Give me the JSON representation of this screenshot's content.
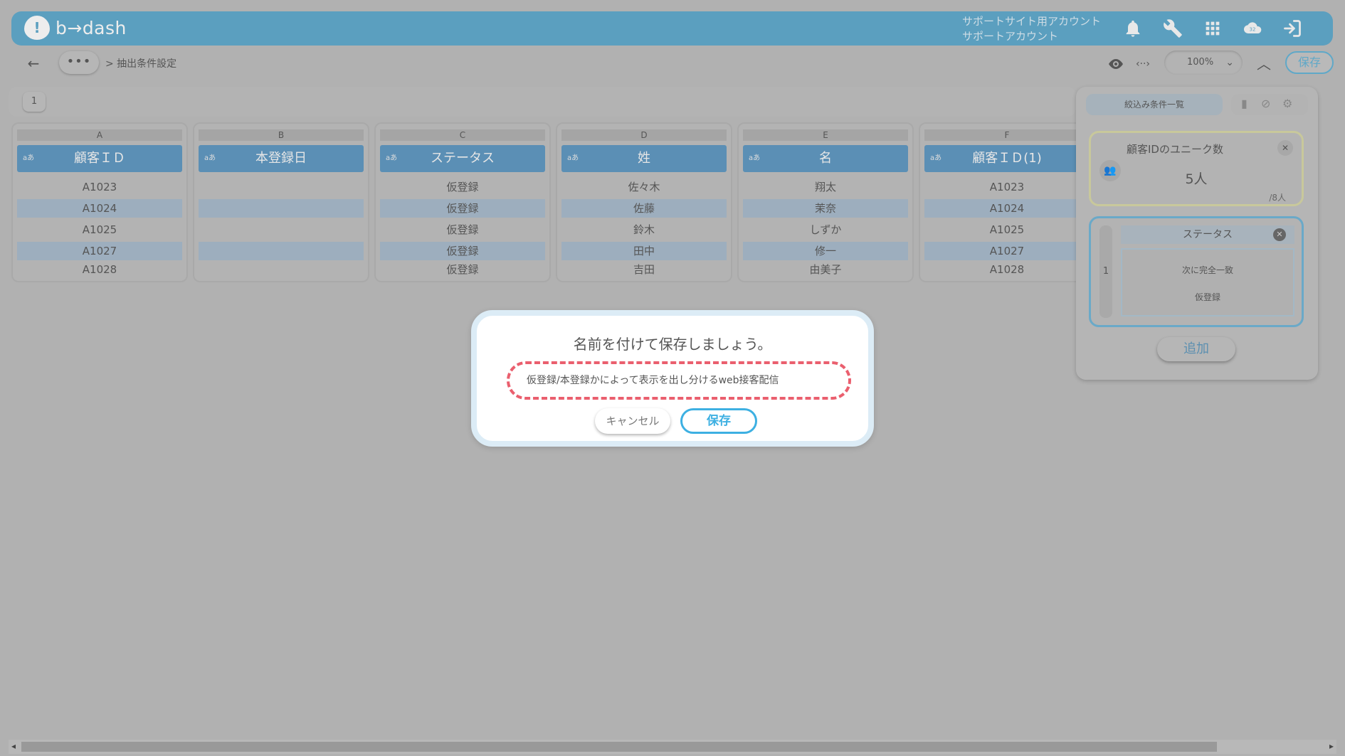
{
  "app": {
    "logo_text": "b→dash",
    "account_line1": "サポートサイト用アカウント",
    "account_line2": "サポートアカウント",
    "notification_badge": "32"
  },
  "toolbar": {
    "more_label": "•••",
    "breadcrumb": "> 抽出条件設定",
    "zoom": "100%",
    "save_label": "保存"
  },
  "pages": [
    "1"
  ],
  "table": {
    "columns": [
      {
        "letter": "A",
        "type": "aあ",
        "header": "顧客ＩＤ",
        "cells": [
          "A1023",
          "A1024",
          "A1025",
          "A1027",
          "A1028"
        ]
      },
      {
        "letter": "B",
        "type": "aあ",
        "header": "本登録日",
        "cells": [
          "",
          "",
          "",
          "",
          ""
        ]
      },
      {
        "letter": "C",
        "type": "aあ",
        "header": "ステータス",
        "cells": [
          "仮登録",
          "仮登録",
          "仮登録",
          "仮登録",
          "仮登録"
        ]
      },
      {
        "letter": "D",
        "type": "aあ",
        "header": "姓",
        "cells": [
          "佐々木",
          "佐藤",
          "鈴木",
          "田中",
          "吉田"
        ]
      },
      {
        "letter": "E",
        "type": "aあ",
        "header": "名",
        "cells": [
          "翔太",
          "茉奈",
          "しずか",
          "修一",
          "由美子"
        ]
      },
      {
        "letter": "F",
        "type": "aあ",
        "header": "顧客ＩＤ(1)",
        "cells": [
          "A1023",
          "A1024",
          "A1025",
          "A1027",
          "A1028"
        ]
      }
    ]
  },
  "panel": {
    "tab_label": "絞込み条件一覧",
    "unique_card": {
      "title": "顧客IDのユニーク数",
      "value": "5人",
      "total": "/8人"
    },
    "condition": {
      "index": "1",
      "field": "ステータス",
      "operator": "次に完全一致",
      "value": "仮登録"
    },
    "add_label": "追加"
  },
  "modal": {
    "title": "名前を付けて保存しましょう。",
    "input_value": "仮登録/本登録かによって表示を出し分けるweb接客配信",
    "cancel_label": "キャンセル",
    "save_label": "保存"
  }
}
